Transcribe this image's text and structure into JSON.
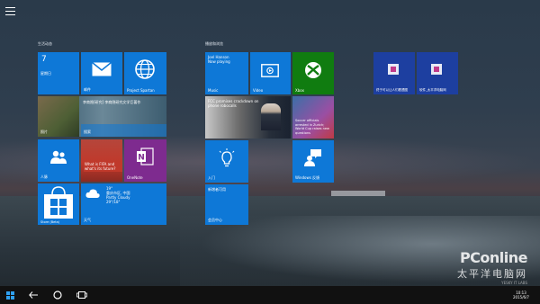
{
  "groups": {
    "life": "生活动态",
    "play": "播放和浏览"
  },
  "tiles": {
    "calendar": {
      "day": "7",
      "weekday": "星期日"
    },
    "mail": {
      "label": "邮件"
    },
    "spartan": {
      "label": "Project Spartan"
    },
    "news_strip": {
      "text": "李商隐[研究] 李商隐研究文学巨著作"
    },
    "photos": {
      "label": "照片"
    },
    "search": {
      "label": "搜索"
    },
    "people": {
      "label": "人脉"
    },
    "fifa": {
      "text": "What is FIFA and what's its future?"
    },
    "onenote": {
      "label": "OneNote"
    },
    "store": {
      "label": "Store (Beta)"
    },
    "weather": {
      "temp": "19°",
      "city": "重庆市区, 中国",
      "cond": "Partly Cloudy",
      "range": "29°/18°",
      "label": "天气"
    },
    "music": {
      "line1": "Joel Hanson",
      "line2": "Now playing",
      "label": "Music"
    },
    "video": {
      "label": "Video"
    },
    "xbox": {
      "label": "Xbox"
    },
    "news_fcc": {
      "text": "FCC promises crackdown on phone robocalls"
    },
    "soccer": {
      "text": "Soccer officials arrested in Zurich; World Cup raises new questions"
    },
    "getstarted": {
      "label": "入门"
    },
    "feedback": {
      "label": "Windows 反馈"
    },
    "news_bottom": {
      "label": "新增者可用"
    },
    "money": {
      "label": "会员中心"
    },
    "app_a": {
      "label": "终于可以让人们看透图"
    },
    "app_b": {
      "label": "软件_太平洋电脑网"
    }
  },
  "watermark": {
    "brand": "PConline",
    "cn": "太平洋电脑网",
    "sub": "YESKY IT LABS"
  },
  "taskbar": {
    "time": "10:13",
    "date": "2015/6/7"
  },
  "colors": {
    "tile_blue": "#0e78d7",
    "xbox_green": "#107c10",
    "onenote_purple": "#7e2b8f"
  }
}
